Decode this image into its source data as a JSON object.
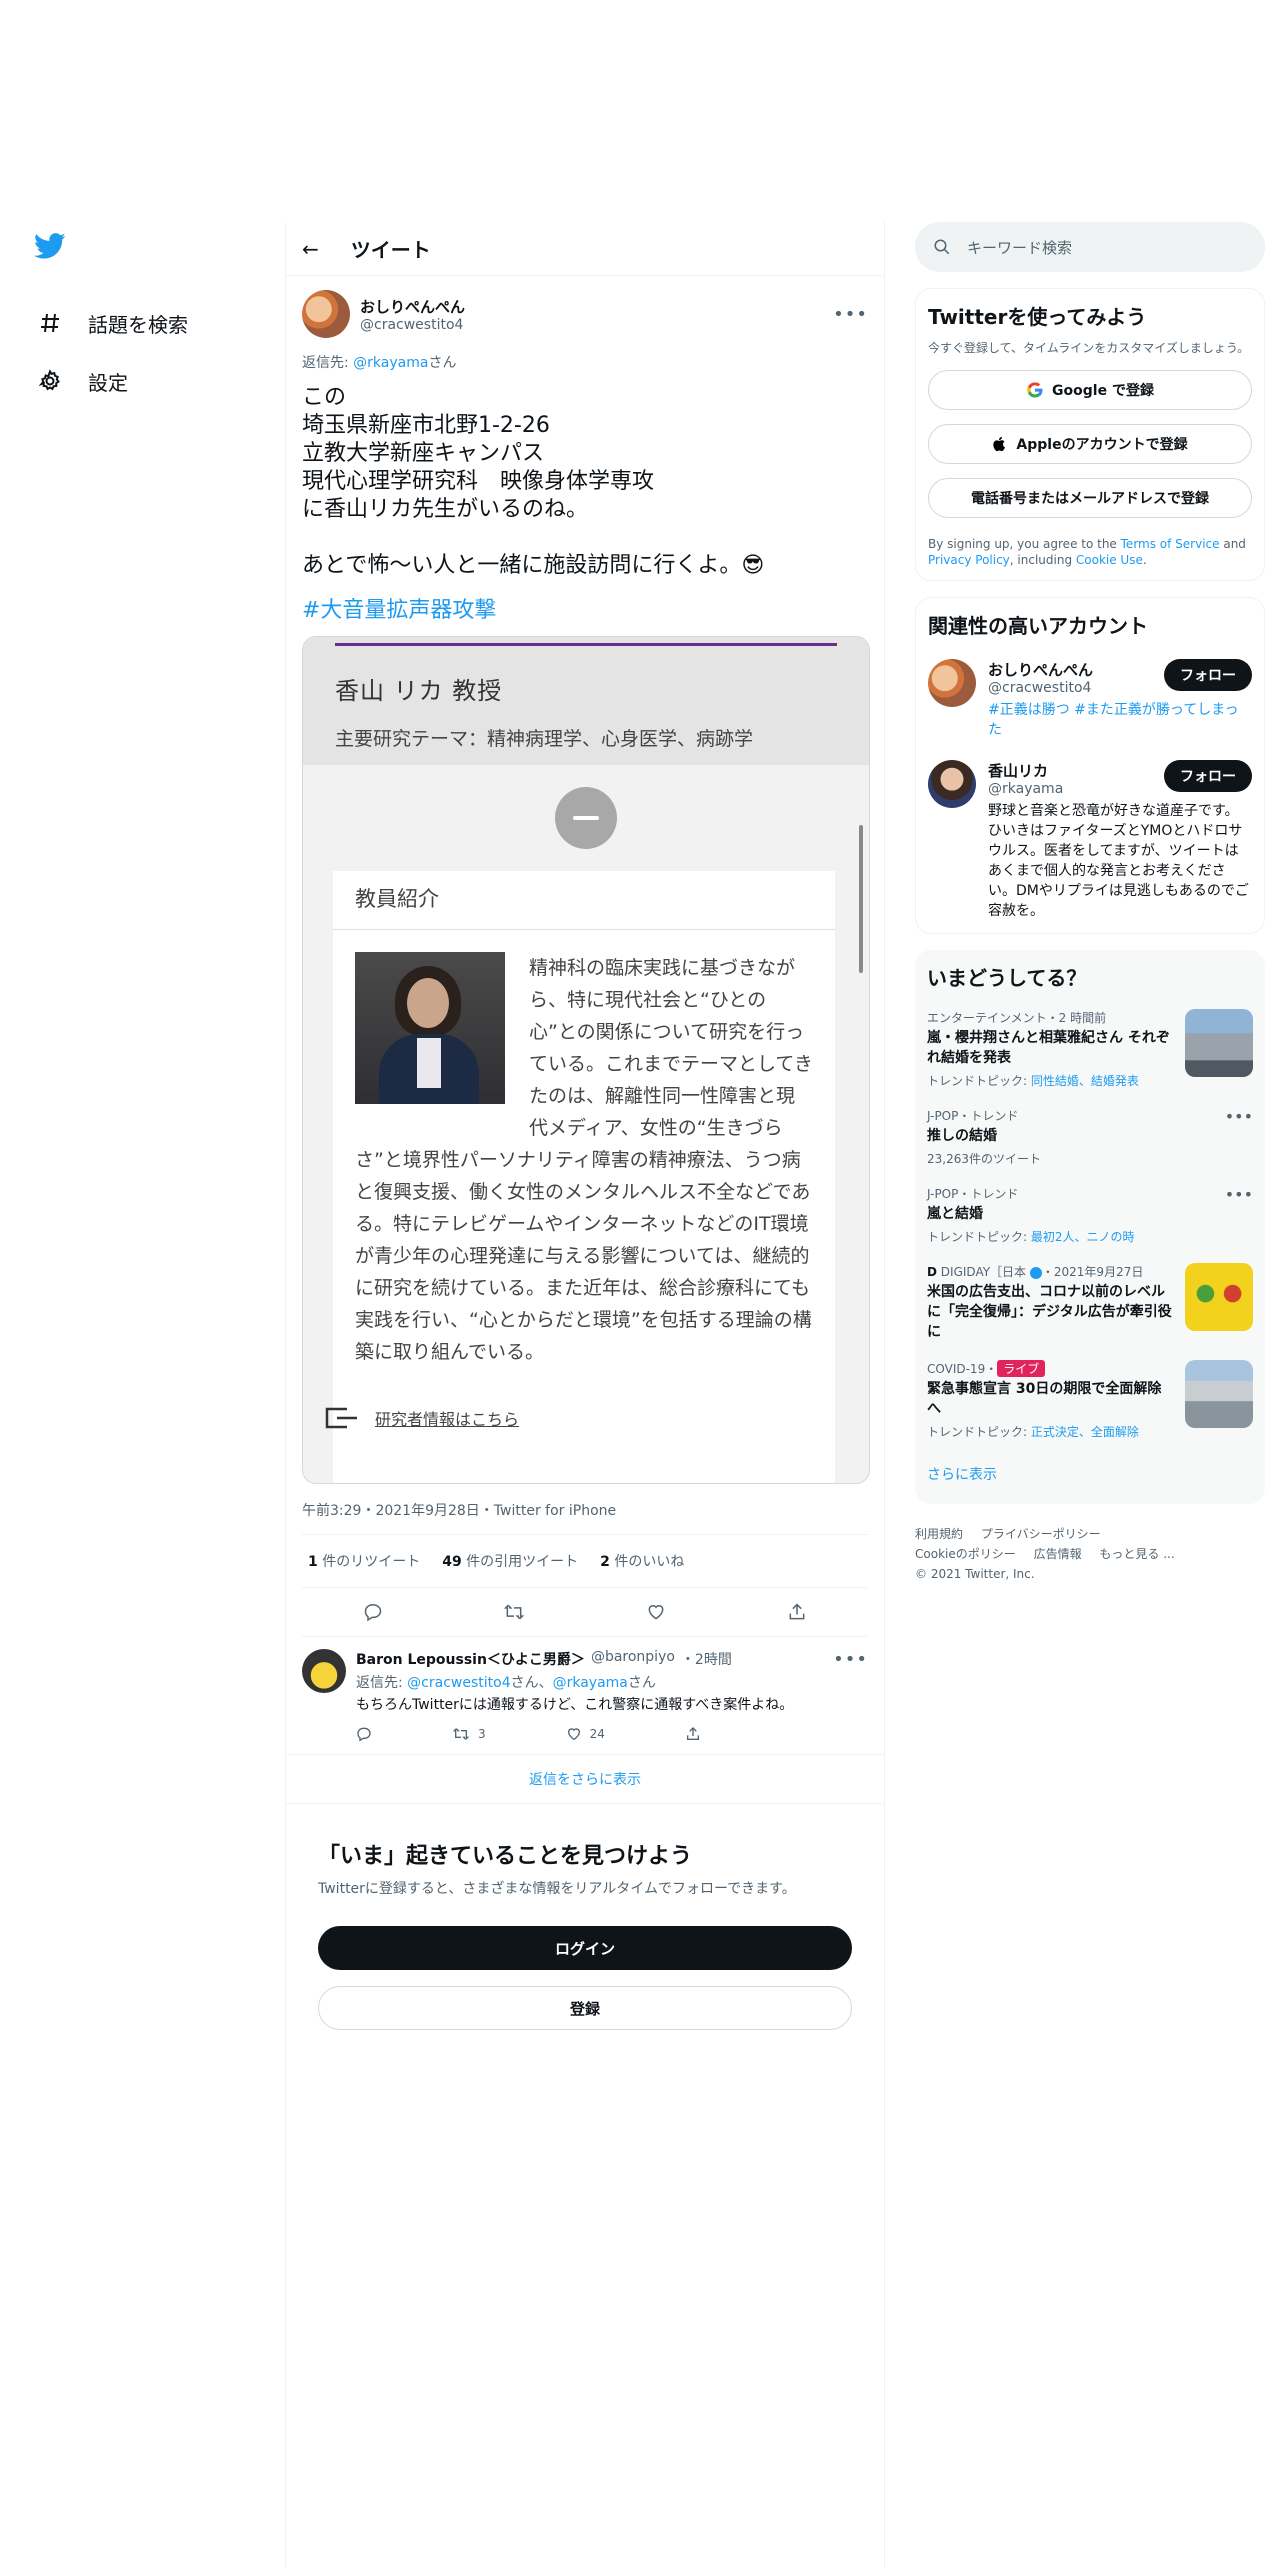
{
  "nav": {
    "explore_label": "話題を検索",
    "settings_label": "設定"
  },
  "header": {
    "back": "←",
    "title": "ツイート"
  },
  "tweet": {
    "display_name": "おしりぺんぺん",
    "handle": "@cracwestito4",
    "reply_prefix": "返信先: ",
    "reply_handle": "@rkayama",
    "reply_suffix": "さん",
    "text": "この\n埼玉県新座市北野1-2-26\n立教大学新座キャンパス\n現代心理学研究科　映像身体学専攻\nに香山リカ先生がいるのね。\n\nあとで怖〜い人と一緒に施設訪問に行くよ。😎",
    "hashtag": "#大音量拡声器攻撃",
    "card": {
      "professor": "香山 リカ 教授",
      "theme": "主要研究テーマ：精神病理学、心身医学、病跡学",
      "intro_title": "教員紹介",
      "intro_body": "精神科の臨床実践に基づきながら、特に現代社会と“ひとの心”との関係について研究を行っている。これまでテーマとしてきたのは、解離性同一性障害と現代メディア、女性の“生きづらさ”と境界性パーソナリティ障害の精神療法、うつ病と復興支援、働く女性のメンタルヘルス不全などである。特にテレビゲームやインターネットなどのIT環境が青少年の心理発達に与える影響については、継続的に研究を続けている。また近年は、総合診療科にても実践を行い、“心とからだと環境”を包括する理論の構築に取り組んでいる。",
      "researcher_link": "研究者情報はこちら"
    },
    "meta": "午前3:29・2021年9月28日・Twitter for iPhone",
    "retweets_n": "1",
    "retweets_label": " 件のリツイート",
    "quotes_n": "49",
    "quotes_label": " 件の引用ツイート",
    "likes_n": "2",
    "likes_label": " 件のいいね"
  },
  "reply": {
    "display_name": "Baron Lepoussin＜ひよこ男爵＞",
    "handle": "@baronpiyo",
    "time": "・2時間",
    "reply_prefix": "返信先: ",
    "reply_handle1": "@cracwestito4",
    "reply_mid": "さん、",
    "reply_handle2": "@rkayama",
    "reply_suffix": "さん",
    "text": "もちろんTwitterには通報するけど、これ警察に通報すべき案件よね。",
    "retweets": "3",
    "likes": "24"
  },
  "show_more_replies": "返信をさらに表示",
  "discover": {
    "title": "「いま」起きていることを見つけよう",
    "subtitle": "Twitterに登録すると、さまざまな情報をリアルタイムでフォローできます。",
    "login": "ログイン",
    "signup": "登録"
  },
  "search": {
    "placeholder": "キーワード検索"
  },
  "try_twitter": {
    "title": "Twitterを使ってみよう",
    "subtitle": "今すぐ登録して、タイムラインをカスタマイズしましょう。",
    "google": "Google で登録",
    "apple": "Appleのアカウントで登録",
    "phone_email": "電話番号またはメールアドレスで登録",
    "terms_pre": "By signing up, you agree to the ",
    "terms_tos": "Terms of Service",
    "terms_and": " and ",
    "terms_privacy": "Privacy Policy",
    "terms_including": ", including ",
    "terms_cookie": "Cookie Use",
    "terms_end": "."
  },
  "related": {
    "title": "関連性の高いアカウント",
    "follow": "フォロー",
    "accounts": [
      {
        "display_name": "おしりぺんぺん",
        "handle": "@cracwestito4",
        "bio": "#正義は勝つ #また正義が勝ってしまった"
      },
      {
        "display_name": "香山リカ",
        "handle": "@rkayama",
        "bio": "野球と音楽と恐竜が好きな道産子です。ひいきはファイターズとYMOとハドロサウルス。医者をしてますが、ツイートはあくまで個人的な発言とお考えください。DMやリプライは見逃しもあるのでご容赦を。"
      }
    ]
  },
  "trends": {
    "title": "いまどうしてる？",
    "items": [
      {
        "category": "エンターテインメント・2 時間前",
        "title": "嵐・櫻井翔さんと相葉雅紀さん それぞれ結婚を発表",
        "topic_label": "トレンドトピック: ",
        "topic": "同性結婚、結婚発表"
      },
      {
        "category": "J-POP・トレンド",
        "title": "推しの結婚",
        "topic_label": "",
        "topic": "23,263件のツイート"
      },
      {
        "category": "J-POP・トレンド",
        "title": "嵐と結婚",
        "topic_label": "トレンドトピック: ",
        "topic": "最初2人、ニノの時"
      },
      {
        "category": "DIGIDAY［日本",
        "category2": "・2021年9月27日",
        "title": "米国の広告支出、コロナ以前のレベルに「完全復帰」：デジタル広告が牽引役に",
        "topic_label": "",
        "topic": ""
      },
      {
        "category": "COVID-19・",
        "live": "ライブ",
        "title": "緊急事態宣言 30日の期限で全面解除へ",
        "topic_label": "トレンドトピック: ",
        "topic": "正式決定、全面解除"
      }
    ],
    "show_more": "さらに表示"
  },
  "footer": {
    "terms": "利用規約",
    "privacy": "プライバシーポリシー",
    "cookie": "Cookieのポリシー",
    "ads": "広告情報",
    "more": "もっと見る ...",
    "copyright": "© 2021 Twitter, Inc."
  }
}
